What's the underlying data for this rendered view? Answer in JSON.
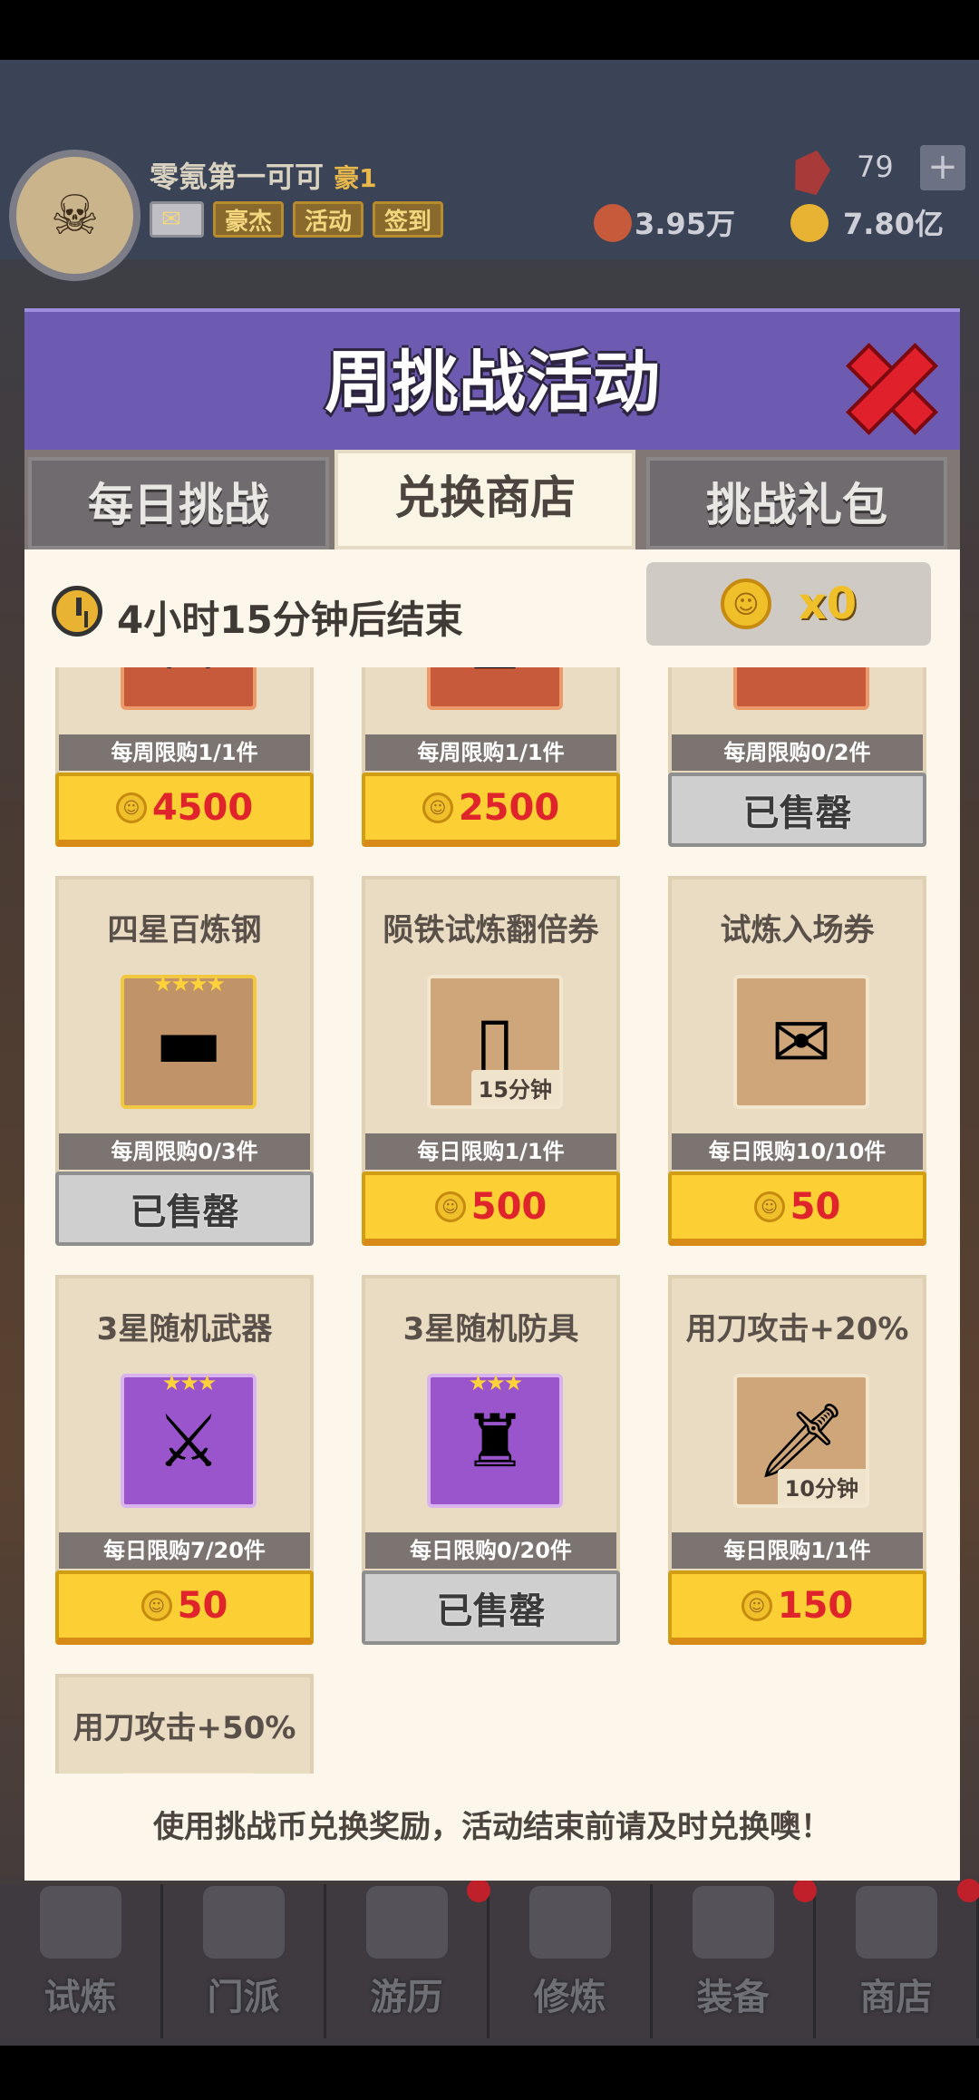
{
  "player": {
    "name": "零氪第一可可",
    "rank": "豪1",
    "chips": [
      "豪杰",
      "活动",
      "签到"
    ],
    "gems": "79",
    "power": "3.95万",
    "gold": "7.80亿"
  },
  "modal": {
    "title": "周挑战活动",
    "tabs": [
      "每日挑战",
      "兑换商店",
      "挑战礼包"
    ],
    "active_tab": "兑换商店",
    "timer": "4小时15分钟后结束",
    "coin_count": "x0",
    "footer": "使用挑战币兑换奖励，活动结束前请及时兑换噢！"
  },
  "items": [
    {
      "name": "",
      "icon": "crossed-swords-icon",
      "style": "orange",
      "stars": "",
      "badge": "",
      "limit": "每周限购1/1件",
      "price": "4500",
      "sold": false
    },
    {
      "name": "",
      "icon": "armor-icon",
      "style": "orange",
      "stars": "",
      "badge": "",
      "limit": "每周限购1/1件",
      "price": "2500",
      "sold": false
    },
    {
      "name": "",
      "icon": "steel-ingot-icon",
      "style": "orange",
      "stars": "",
      "badge": "",
      "limit": "每周限购0/2件",
      "price": "已售罄",
      "sold": true
    },
    {
      "name": "四星百炼钢",
      "icon": "steel-ingot-icon",
      "style": "gold",
      "stars": "★★★★",
      "badge": "",
      "limit": "每周限购0/3件",
      "price": "已售罄",
      "sold": true
    },
    {
      "name": "陨铁试炼翻倍券",
      "icon": "card-15-icon",
      "style": "tan",
      "stars": "",
      "badge": "15分钟",
      "limit": "每日限购1/1件",
      "price": "500",
      "sold": false
    },
    {
      "name": "试炼入场券",
      "icon": "ticket-icon",
      "style": "tan",
      "stars": "",
      "badge": "",
      "limit": "每日限购10/10件",
      "price": "50",
      "sold": false
    },
    {
      "name": "3星随机武器",
      "icon": "crossed-swords-icon",
      "style": "purple",
      "stars": "★★★",
      "badge": "",
      "limit": "每日限购7/20件",
      "price": "50",
      "sold": false
    },
    {
      "name": "3星随机防具",
      "icon": "armor-icon",
      "style": "purple",
      "stars": "★★★",
      "badge": "",
      "limit": "每日限购0/20件",
      "price": "已售罄",
      "sold": true
    },
    {
      "name": "用刀攻击+20%",
      "icon": "knife-icon",
      "style": "tan",
      "stars": "",
      "badge": "10分钟",
      "limit": "每日限购1/1件",
      "price": "150",
      "sold": false
    },
    {
      "name": "用刀攻击+50%",
      "icon": "knife-icon",
      "style": "tan",
      "stars": "",
      "badge": "",
      "limit": "",
      "price": "",
      "sold": false
    }
  ],
  "nav": [
    "试炼",
    "门派",
    "游历",
    "修炼",
    "装备",
    "商店"
  ]
}
